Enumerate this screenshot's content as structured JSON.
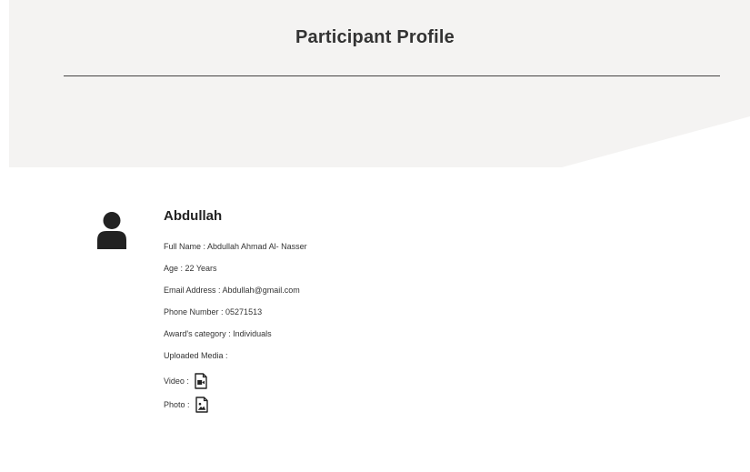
{
  "header": {
    "title": "Participant Profile"
  },
  "profile": {
    "name": "Abdullah",
    "fields": [
      "Full Name : Abdullah Ahmad Al- Nasser",
      "Age : 22 Years",
      "Email Address : Abdullah@gmail.com",
      "Phone Number : 05271513",
      "Award's category : Individuals",
      "Uploaded Media :"
    ],
    "media": {
      "video_label": "Video :",
      "video_icon": "video-file-icon",
      "photo_label": "Photo :",
      "photo_icon": "image-file-icon"
    }
  },
  "colors": {
    "header_band": "#f4f3f2",
    "rule": "#444444",
    "icon": "#222222"
  }
}
